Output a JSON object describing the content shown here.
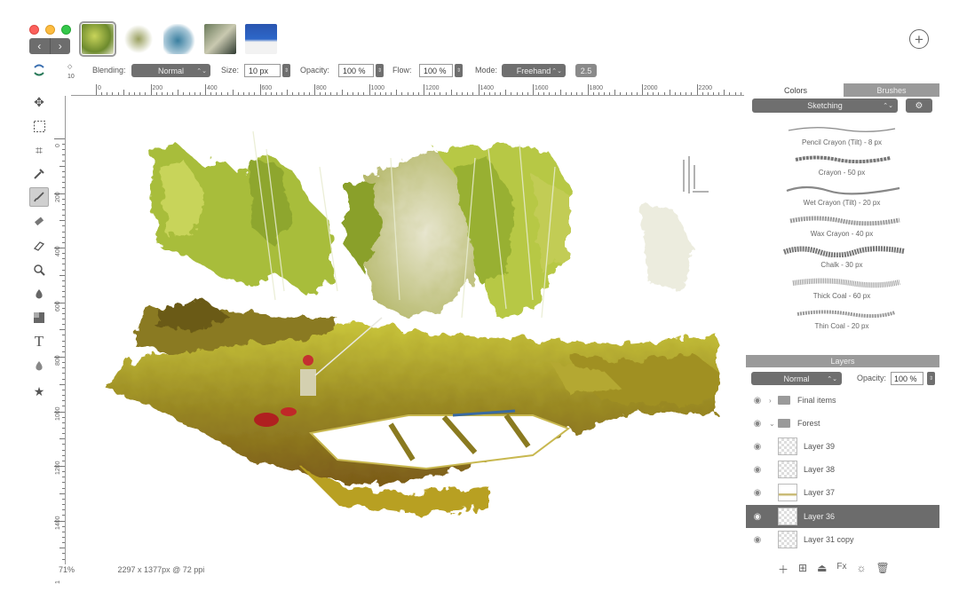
{
  "document": {
    "thumbnail_count": 5
  },
  "nav": {
    "back": "‹",
    "forward": "›"
  },
  "options": {
    "blending_label": "Blending:",
    "blending_value": "Normal",
    "size_label": "Size:",
    "size_value": "10 px",
    "opacity_label": "Opacity:",
    "opacity_value": "100 %",
    "flow_label": "Flow:",
    "flow_value": "100 %",
    "mode_label": "Mode:",
    "mode_value": "Freehand",
    "extra_value": "2.5"
  },
  "toolbar": {
    "top_number": "10",
    "tools": [
      "move-icon",
      "marquee-icon",
      "crop-icon",
      "eyedropper-icon",
      "brush-icon",
      "eraser-icon",
      "smudge-icon",
      "zoom-icon",
      "fill-icon",
      "shape-icon",
      "text-icon",
      "dropper-icon",
      "star-icon"
    ]
  },
  "rulers": {
    "horizontal": [
      "0",
      "200",
      "400",
      "600",
      "800",
      "1000",
      "1200",
      "1400",
      "1600",
      "1800",
      "2000",
      "2200",
      "2"
    ],
    "vertical": [
      "0",
      "200",
      "400",
      "600",
      "800",
      "1000",
      "1200",
      "1400",
      "1"
    ]
  },
  "status": {
    "zoom": "71%",
    "dimensions": "2297 x 1377px @ 72 ppi"
  },
  "panel": {
    "tab_colors": "Colors",
    "tab_brushes": "Brushes",
    "brush_set": "Sketching",
    "brushes": [
      {
        "name": "Pencil Crayon (Tilt) - 8 px"
      },
      {
        "name": "Crayon - 50 px"
      },
      {
        "name": "Wet Crayon (Tilt) - 20 px"
      },
      {
        "name": "Wax Crayon - 40 px"
      },
      {
        "name": "Chalk - 30 px"
      },
      {
        "name": "Thick Coal - 60 px"
      },
      {
        "name": "Thin Coal - 20 px"
      }
    ]
  },
  "layers": {
    "header": "Layers",
    "mode": "Normal",
    "opacity_label": "Opacity:",
    "opacity_value": "100 %",
    "items": [
      {
        "name": "Final items",
        "type": "group"
      },
      {
        "name": "Forest",
        "type": "group"
      },
      {
        "name": "Layer 39",
        "type": "layer"
      },
      {
        "name": "Layer 38",
        "type": "layer"
      },
      {
        "name": "Layer 37",
        "type": "layer"
      },
      {
        "name": "Layer 36",
        "type": "layer",
        "selected": true
      },
      {
        "name": "Layer 31 copy",
        "type": "layer"
      }
    ],
    "actions": [
      "add-layer-icon",
      "add-group-icon",
      "merge-icon",
      "fx-icon",
      "adjust-icon",
      "trash-icon"
    ],
    "fx_label": "Fx"
  },
  "colors": {
    "accent": "#6c6c6c",
    "painting_green": "#a8b830",
    "painting_olive": "#8a7a20"
  }
}
